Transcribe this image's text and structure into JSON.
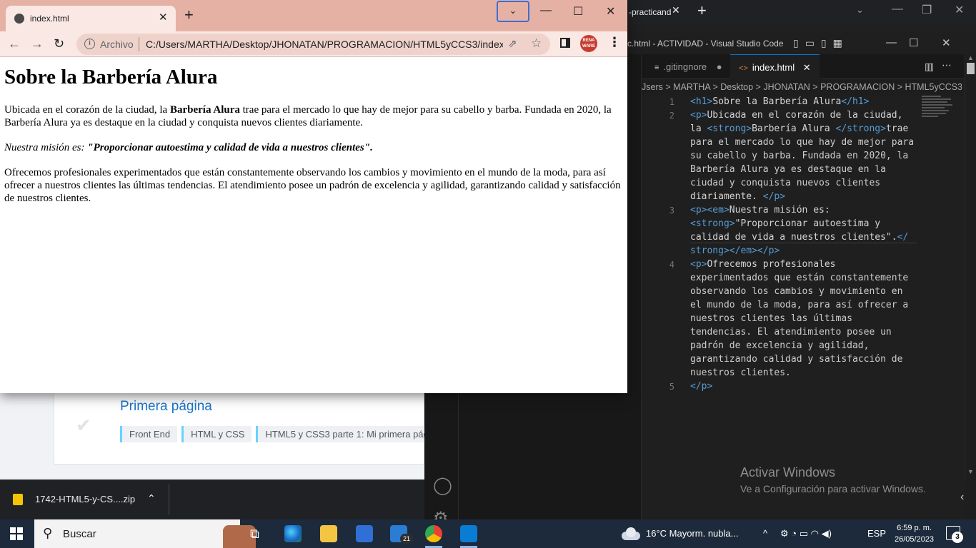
{
  "chrome": {
    "tab_title": "index.html",
    "scheme_label": "Archivo",
    "url": "C:/Users/MARTHA/Desktop/JHONATAN/PROGRAMACION/HTML5yCCS3/index...",
    "extension_label": "RENA WARE"
  },
  "page": {
    "heading": "Sobre la Barbería Alura",
    "p1_before": "Ubicada en el corazón de la ciudad, la ",
    "p1_strong": "Barbería Alura",
    "p1_after": " trae para el mercado lo que hay de mejor para su cabello y barba. Fundada en 2020, la Barbería Alura ya es destaque en la ciudad y conquista nuevos clientes diariamente.",
    "p2_em": "Nuestra misión es: ",
    "p2_strong": "\"Proporcionar autoestima y calidad de vida a nuestros clientes\".",
    "p3": "Ofrecemos profesionales experimentados que están constantemente observando los cambios y movimiento en el mundo de la moda, para así ofrecer a nuestros clientes las últimas tendencias. El atendimiento posee un padrón de excelencia y agilidad, garantizando calidad y satisfacción de nuestros clientes."
  },
  "background_browser": {
    "tab_text": "-practicand"
  },
  "alura": {
    "title": "Primera página",
    "chips": [
      "Front End",
      "HTML y CSS",
      "HTML5 y CSS3 parte 1: Mi primera pág"
    ]
  },
  "downloads": {
    "file_name": "1742-HTML5-y-CS....zip"
  },
  "vscode": {
    "title": "c.html - ACTIVIDAD - Visual Studio Code",
    "tabs": [
      ".gitingnore",
      "index.html"
    ],
    "breadcrumb": "Jsers  >  MARTHA  >  Desktop  >  JHONATAN  >  PROGRAMACION  >  HTML5yCCS3",
    "line_numbers": [
      "1",
      "2",
      "3",
      "4",
      "5"
    ],
    "code": {
      "l1_text": "Sobre la Barbería Alura",
      "l2_a": "Ubicada en el corazón de la ciudad,",
      "l2_b": "la ",
      "l2_c": "Barbería Alura ",
      "l2_d": "trae",
      "l2_e": "para el mercado lo que hay de mejor para",
      "l2_f": "su cabello y barba. Fundada en 2020, la",
      "l2_g": "Barbería Alura ya es destaque en la",
      "l2_h": "ciudad y conquista nuevos clientes",
      "l2_i": "diariamente. ",
      "l3_a": "Nuestra misión es:",
      "l3_b": "\"Proporcionar autoestima y",
      "l3_c": "calidad de vida a nuestros clientes\".",
      "l4_a": "Ofrecemos profesionales",
      "l4_b": "experimentados que están constantemente",
      "l4_c": "observando los cambios y movimiento en",
      "l4_d": "el mundo de la moda, para así ofrecer a",
      "l4_e": "nuestros clientes las últimas",
      "l4_f": "tendencias. El atendimiento posee un",
      "l4_g": "padrón de excelencia y agilidad,",
      "l4_h": "garantizando calidad y satisfacción de",
      "l4_i": "nuestros clientes."
    },
    "activate_title": "Activar Windows",
    "activate_sub": "Ve a Configuración para activar Windows."
  },
  "taskbar": {
    "search_placeholder": "Buscar",
    "weather": "16°C  Mayorm. nubla...",
    "language": "ESP",
    "time": "6:59 p. m.",
    "date": "26/05/2023",
    "notifications": "3",
    "edge_badge": "21"
  }
}
